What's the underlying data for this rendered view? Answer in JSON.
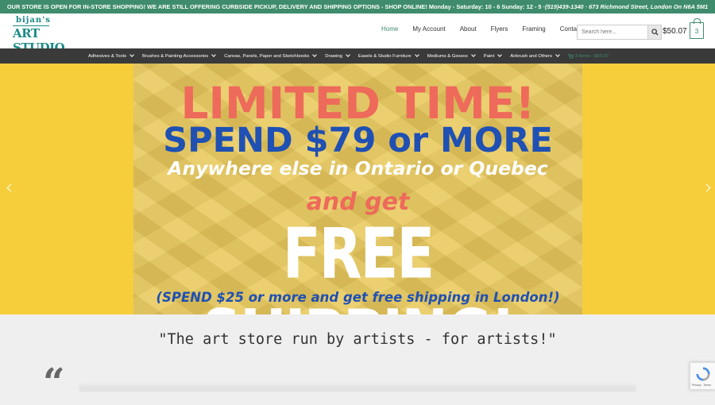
{
  "announcement": {
    "text": "OUR STORE IS OPEN FOR IN-STORE SHOPPING! WE ARE STILL OFFERING CURBSIDE PICKUP, DELIVERY AND SHIPPING OPTIONS - SHOP ONLINE! Monday - Saturday: 10 - 6 Sunday: 12 - 5 · ",
    "contact": "(519)439-1340 · 673 Richmond Street, London On N6A 5M1"
  },
  "logo": {
    "line1": "bijan's",
    "line2": "ART STUDIO"
  },
  "nav": {
    "items": [
      "Home",
      "My Account",
      "About",
      "Flyers",
      "Framing",
      "Contact"
    ]
  },
  "search": {
    "placeholder": "Search here..."
  },
  "cart": {
    "total": "$50.07",
    "count": "3",
    "mini": "3 items - $50.07"
  },
  "categories": [
    "Adhesives & Tools",
    "Brushes & Painting Accessories",
    "Canvas, Panels, Paper and Sketchbooks",
    "Drawing",
    "Easels & Studio Furniture",
    "Mediums & Gessos",
    "Paint",
    "Airbrush and Others"
  ],
  "banner": {
    "line1": "LIMITED TIME!",
    "line2": "SPEND $79 or MORE",
    "line3": "Anywhere else in Ontario or Quebec",
    "line4": "and get",
    "line5": "FREE SHIPPING!",
    "line6": "(SPEND $25 or more and get free shipping in London!)"
  },
  "tagline": "\"The art store run by artists - for artists!\"",
  "quote_mark": "“",
  "recaptcha": {
    "text": "Privacy - Terms"
  },
  "colors": {
    "accent": "#3f8c6c",
    "dark_nav": "#3a3a3a",
    "hero_yellow": "#f6ce3c"
  }
}
